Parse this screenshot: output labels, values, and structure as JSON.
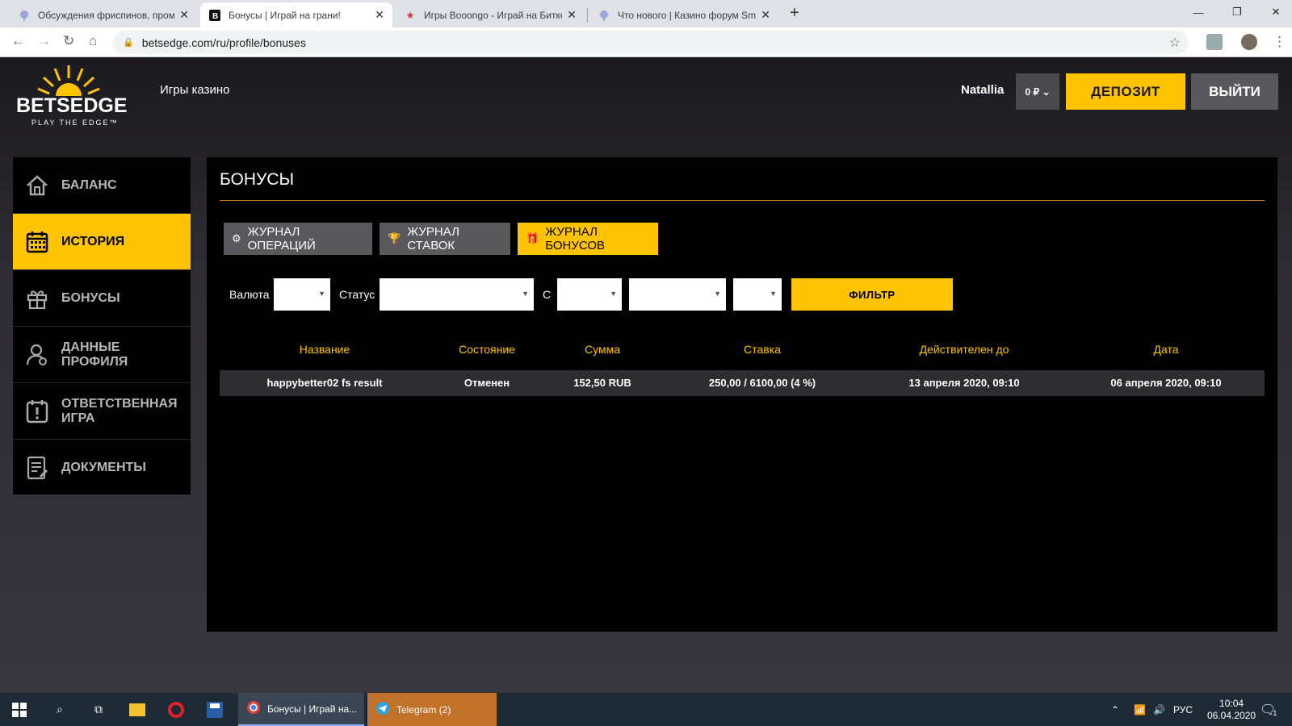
{
  "browser": {
    "tabs": [
      {
        "title": "Обсуждения фриспинов, промо",
        "icon": "globe-icon"
      },
      {
        "title": "Бонусы | Играй на грани!",
        "icon": "betsedge-icon"
      },
      {
        "title": "Игры Booongo - Играй на Битко",
        "icon": "star-icon"
      },
      {
        "title": "Что нового | Казино форум Smo",
        "icon": "globe-icon"
      }
    ],
    "new_tab": "+",
    "url": "betsedge.com/ru/profile/bonuses",
    "window": {
      "minimize": "—",
      "restore": "❐",
      "close": "✕"
    }
  },
  "site": {
    "logo": {
      "brand": "BETSEDGE",
      "tagline": "PLAY THE EDGE™"
    },
    "nav_casino": "Игры казино",
    "username": "Natallia",
    "balance": "0 ₽ ⌄",
    "deposit_label": "ДЕПОЗИТ",
    "logout_label": "ВЫЙТИ",
    "accent": "#ffc300"
  },
  "sidebar": {
    "items": [
      {
        "label": "БАЛАНС",
        "icon": "home-icon",
        "active": false
      },
      {
        "label": "ИСТОРИЯ",
        "icon": "calendar-icon",
        "active": true
      },
      {
        "label": "БОНУСЫ",
        "icon": "gift-icon",
        "active": false
      },
      {
        "label": "ДАННЫЕ ПРОФИЛЯ",
        "icon": "user-icon",
        "active": false
      },
      {
        "label": "ОТВЕТСТВЕННАЯ ИГРА",
        "icon": "calendar-alert-icon",
        "active": false
      },
      {
        "label": "ДОКУМЕНТЫ",
        "icon": "document-icon",
        "active": false
      }
    ]
  },
  "main": {
    "title": "БОНУСЫ",
    "journal_buttons": [
      {
        "label": "ЖУРНАЛ ОПЕРАЦИЙ",
        "icon": "gear-icon"
      },
      {
        "label": "ЖУРНАЛ СТАВОК",
        "icon": "trophy-icon"
      },
      {
        "label": "ЖУРНАЛ БОНУСОВ",
        "icon": "gift-icon"
      }
    ],
    "filters": {
      "currency_label": "Валюта",
      "status_label": "Статус",
      "from_label": "С",
      "filter_button": "ФИЛЬТР"
    },
    "table": {
      "columns": [
        "Название",
        "Состояние",
        "Сумма",
        "Ставка",
        "Действителен до",
        "Дата"
      ],
      "rows": [
        [
          "happybetter02 fs result",
          "Отменен",
          "152,50 RUB",
          "250,00 / 6100,00 (4 %)",
          "13 апреля 2020, 09:10",
          "06 апреля 2020, 09:10"
        ]
      ]
    }
  },
  "taskbar": {
    "apps": [
      {
        "label": "Бонусы | Играй на...",
        "icon": "chrome-icon"
      },
      {
        "label": "Telegram (2)",
        "icon": "telegram-icon"
      }
    ],
    "lang": "РУС",
    "time": "10:04",
    "date": "06.04.2020",
    "notifications": "1"
  }
}
